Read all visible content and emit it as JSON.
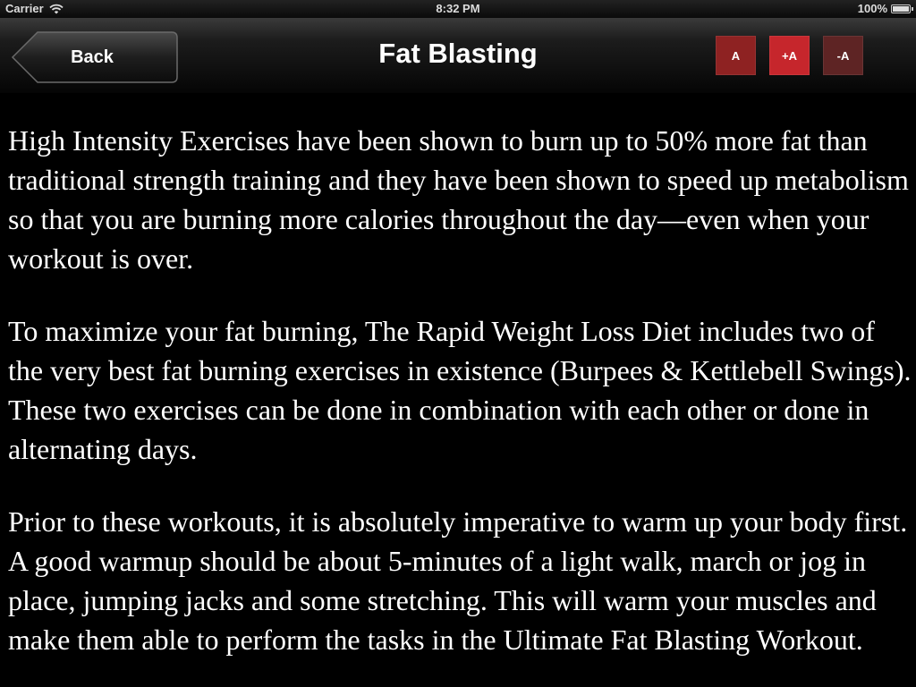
{
  "status_bar": {
    "carrier": "Carrier",
    "time": "8:32 PM",
    "battery": "100%",
    "battery_level": 1.0
  },
  "nav": {
    "back_label": "Back",
    "title": "Fat Blasting",
    "font_buttons": {
      "reset_label": "A",
      "increase_label": "+A",
      "decrease_label": "-A"
    }
  },
  "content": {
    "paragraphs": [
      "High Intensity Exercises have been shown to burn up to 50% more fat than traditional strength training and they have been shown to speed up metabolism so that you are burning more calories throughout the day—even when your workout is over.",
      "To maximize your fat burning, The Rapid Weight Loss Diet includes two of the very best fat burning exercises in existence (Burpees & Kettlebell Swings). These two exercises can be done in combination with each other or done in alternating days.",
      "Prior to these workouts, it is absolutely imperative to warm up your body first. A good warmup should be about 5-minutes of a light walk, march or jog in place, jumping jacks and some stretching. This will warm your muscles and make them able to perform the tasks in the Ultimate Fat Blasting Workout."
    ]
  },
  "icons": {
    "wifi": "wifi-icon",
    "battery": "battery-icon",
    "back_arrow": "back-arrow-icon"
  },
  "colors": {
    "background": "#000000",
    "text": "#ffffff",
    "font_button_reset": "#8e2222",
    "font_button_increase": "#c6262c",
    "font_button_decrease": "#5e2424"
  }
}
